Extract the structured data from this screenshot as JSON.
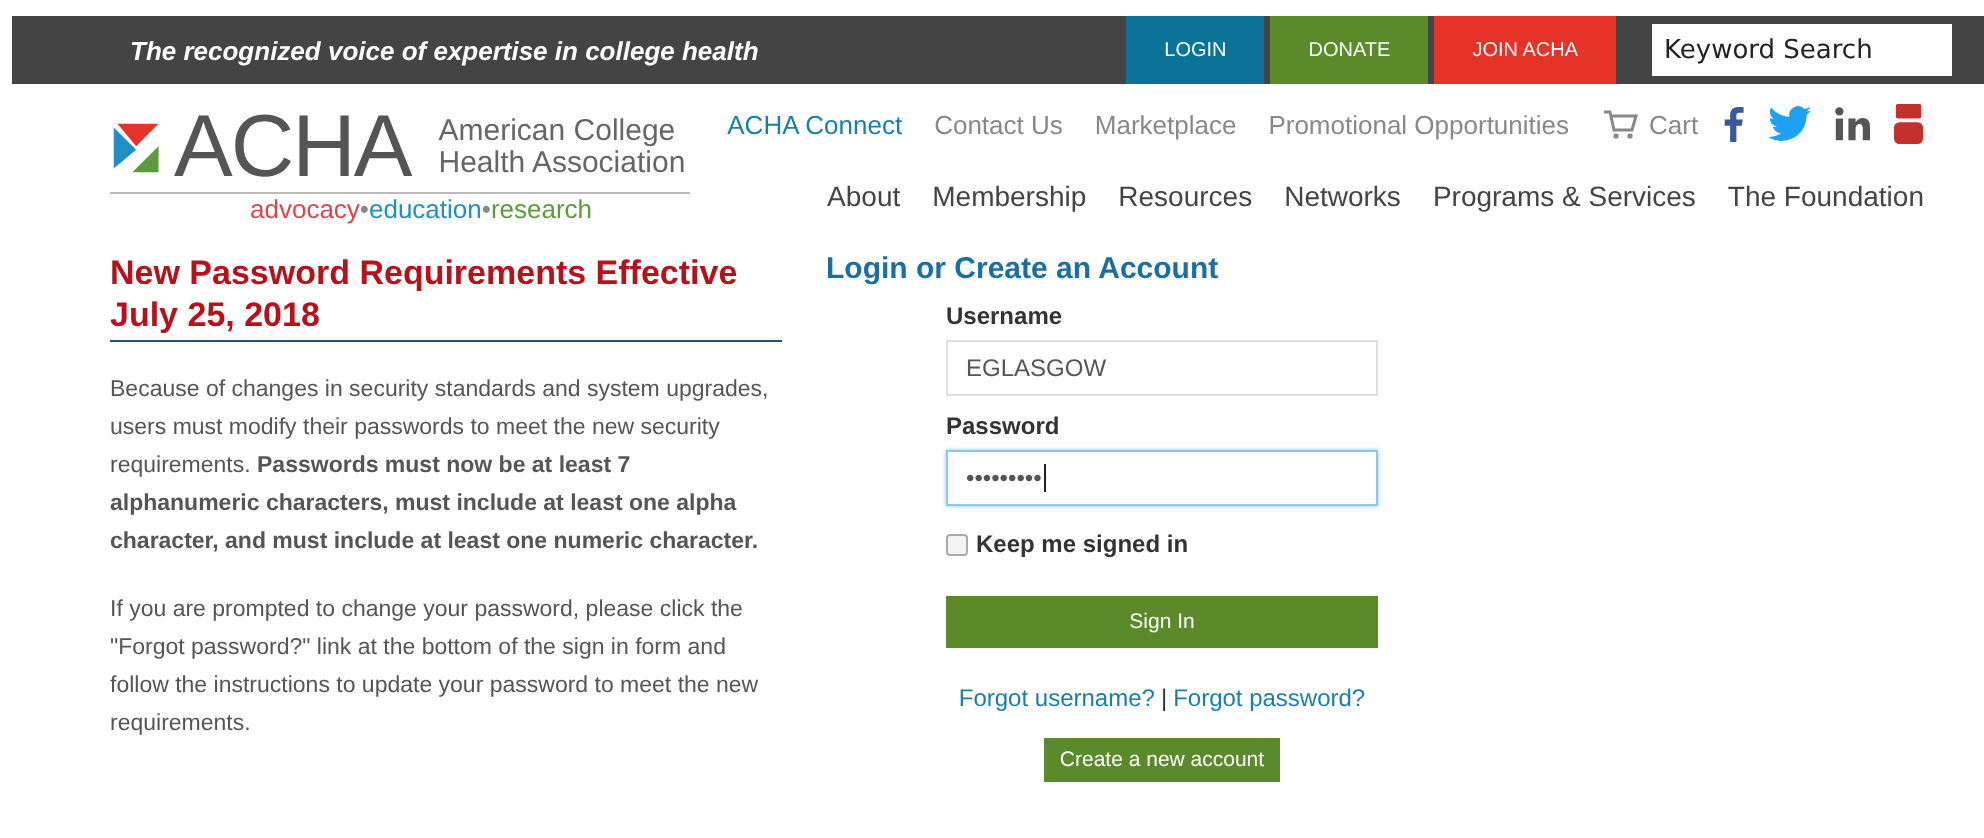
{
  "top_bar": {
    "tagline": "The recognized voice of expertise in college health",
    "buttons": [
      {
        "label": "LOGIN",
        "color": "#0b7397"
      },
      {
        "label": "DONATE",
        "color": "#5b8a2b"
      },
      {
        "label": "JOIN ACHA",
        "color": "#e5332a"
      }
    ],
    "search": {
      "placeholder": "Keyword Search"
    }
  },
  "logo": {
    "acronym": "ACHA",
    "name_lines": [
      "American College",
      "Health Association"
    ],
    "motto": [
      {
        "text": "advocacy",
        "color": "#d9474d"
      },
      {
        "text": "•",
        "color": "#888888"
      },
      {
        "text": "education",
        "color": "#1f8fc6"
      },
      {
        "text": "•",
        "color": "#888888"
      },
      {
        "text": "research",
        "color": "#5f9a3a"
      }
    ]
  },
  "utility_links": [
    {
      "label": "ACHA Connect",
      "selected": true
    },
    {
      "label": "Contact Us",
      "selected": false
    },
    {
      "label": "Marketplace",
      "selected": false
    },
    {
      "label": "Promotional Opportunities",
      "selected": false
    }
  ],
  "cart": "Cart",
  "main_nav": [
    "About",
    "Membership",
    "Resources",
    "Networks",
    "Programs & Services",
    "The Foundation"
  ],
  "notice": {
    "title": "New Password Requirements Effective July 25, 2018",
    "paragraphs": [
      "Because of changes in security standards and system upgrades, users must modify their passwords to meet the new security requirements. **Passwords must now be at least 7 alphanumeric characters, must include at least one alpha character, and must include at least one numeric character.**",
      "If you are prompted to change your password, please click the \"Forgot password?\" link at the bottom of the sign in form and follow the instructions to update your password to meet the new requirements."
    ]
  },
  "login": {
    "title": "Login or Create an Account",
    "fields": [
      {
        "label": "Username",
        "value": "EGLASGOW",
        "focused": false
      },
      {
        "label": "Password",
        "value": "•••••••••",
        "focused": true
      }
    ],
    "keep_signed_in": {
      "label": "Keep me signed in",
      "checked": false
    },
    "sign_in": "Sign In",
    "forgot_username": "Forgot username?",
    "separator": "|",
    "forgot_password": "Forgot password?",
    "create_account": "Create a new account"
  }
}
